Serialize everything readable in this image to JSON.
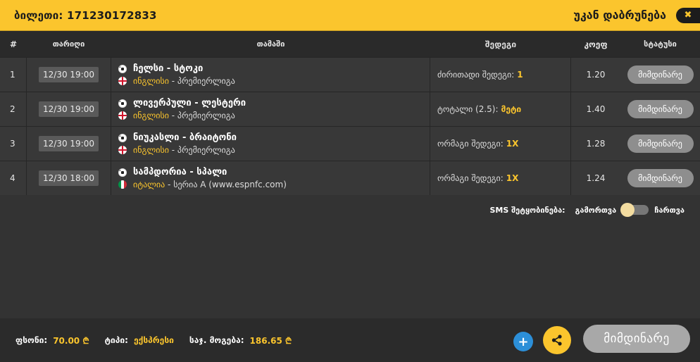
{
  "header": {
    "ticket_label": "ბილეთი: 171230172833",
    "back_label": "უკან დაბრუნება",
    "close_icon": "✖"
  },
  "table": {
    "columns": [
      "#",
      "თარიღი",
      "თამაში",
      "შედეგი",
      "კოეფ",
      "სტატუსი"
    ],
    "rows": [
      {
        "num": "1",
        "date": "12/30 19:00",
        "match": "ჩელსი - სტოკი",
        "country": "ინგლისი",
        "league": " - პრემიერლიგა",
        "flag": "england-flag",
        "bet_label": "ძირითადი შედეგი:",
        "bet_value": "1",
        "odd": "1.20",
        "status": "მიმდინარე"
      },
      {
        "num": "2",
        "date": "12/30 19:00",
        "match": "ლივერპული - ლესტერი",
        "country": "ინგლისი",
        "league": " - პრემიერლიგა",
        "flag": "england-flag",
        "bet_label": "ტოტალი (2.5):",
        "bet_value": "მეტი",
        "odd": "1.40",
        "status": "მიმდინარე"
      },
      {
        "num": "3",
        "date": "12/30 19:00",
        "match": "ნიუკასლი - ბრაიტონი",
        "country": "ინგლისი",
        "league": " - პრემიერლიგა",
        "flag": "england-flag",
        "bet_label": "ორმაგი შედეგი:",
        "bet_value": "1X",
        "odd": "1.28",
        "status": "მიმდინარე"
      },
      {
        "num": "4",
        "date": "12/30 18:00",
        "match": "სამპდორია - სპალი",
        "country": "იტალია",
        "league": " - სერია A (www.espnfc.com)",
        "flag": "italy-flag",
        "bet_label": "ორმაგი შედეგი:",
        "bet_value": "1X",
        "odd": "1.24",
        "status": "მიმდინარე"
      }
    ]
  },
  "sms": {
    "label": "SMS შეტყობინება:",
    "off_label": "გამორთვა",
    "on_label": "ჩართვა"
  },
  "footer": {
    "stake_label": "ფსონი:",
    "stake_value": "70.00 ₾",
    "type_label": "ტიპი:",
    "type_value": "ექსპრესი",
    "win_label": "საჯ. მოგება:",
    "win_value": "186.65 ₾",
    "plus_icon": "+",
    "status_label": "მიმდინარე"
  },
  "colors": {
    "accent": "#fbc52d",
    "background": "#333333",
    "status_button": "#8e8e8e",
    "plus_button": "#2c8fd8"
  }
}
